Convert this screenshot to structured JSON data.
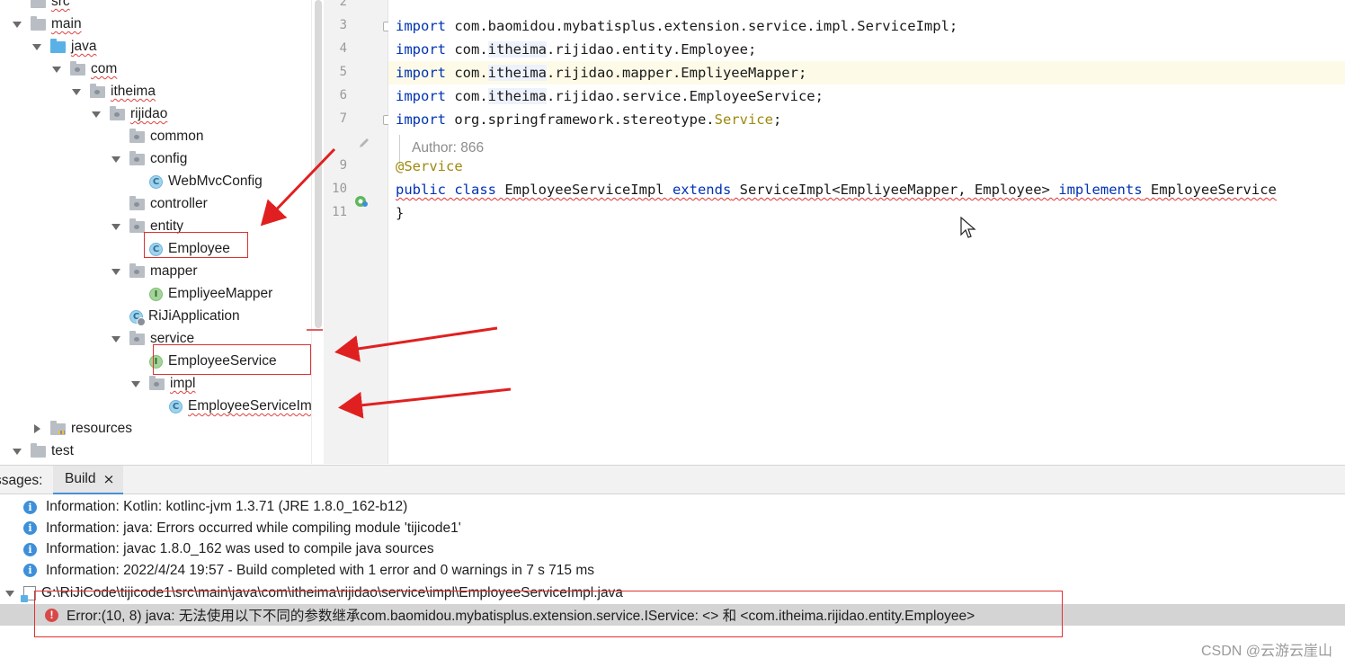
{
  "tree": {
    "items": [
      {
        "label": "src",
        "kind": "folder",
        "arrow": "none",
        "depth": 0,
        "squiggle": true
      },
      {
        "label": "main",
        "kind": "folder",
        "arrow": "down",
        "depth": 0,
        "squiggle": true
      },
      {
        "label": "java",
        "kind": "folder-blue",
        "arrow": "down",
        "depth": 1,
        "squiggle": true
      },
      {
        "label": "com",
        "kind": "package",
        "arrow": "down",
        "depth": 2,
        "squiggle": true
      },
      {
        "label": "itheima",
        "kind": "package",
        "arrow": "down",
        "depth": 3,
        "squiggle": true
      },
      {
        "label": "rijidao",
        "kind": "package",
        "arrow": "down",
        "depth": 4,
        "squiggle": true
      },
      {
        "label": "common",
        "kind": "package",
        "arrow": "none",
        "depth": 5,
        "squiggle": false
      },
      {
        "label": "config",
        "kind": "package",
        "arrow": "down",
        "depth": 5,
        "squiggle": false
      },
      {
        "label": "WebMvcConfig",
        "kind": "class",
        "arrow": "none",
        "depth": 6,
        "squiggle": false
      },
      {
        "label": "controller",
        "kind": "package",
        "arrow": "none",
        "depth": 5,
        "squiggle": false
      },
      {
        "label": "entity",
        "kind": "package",
        "arrow": "down",
        "depth": 5,
        "squiggle": false
      },
      {
        "label": "Employee",
        "kind": "class",
        "arrow": "none",
        "depth": 6,
        "squiggle": false
      },
      {
        "label": "mapper",
        "kind": "package",
        "arrow": "down",
        "depth": 5,
        "squiggle": false
      },
      {
        "label": "EmpliyeeMapper",
        "kind": "interface",
        "arrow": "none",
        "depth": 6,
        "squiggle": false
      },
      {
        "label": "RiJiApplication",
        "kind": "app",
        "arrow": "none",
        "depth": 5,
        "squiggle": false
      },
      {
        "label": "service",
        "kind": "package",
        "arrow": "down",
        "depth": 5,
        "squiggle": false
      },
      {
        "label": "EmployeeService",
        "kind": "interface",
        "arrow": "none",
        "depth": 6,
        "squiggle": false
      },
      {
        "label": "impl",
        "kind": "package",
        "arrow": "down",
        "depth": 6,
        "squiggle": true
      },
      {
        "label": "EmployeeServiceIm",
        "kind": "class",
        "arrow": "none",
        "depth": 7,
        "squiggle": true
      },
      {
        "label": "resources",
        "kind": "resources",
        "arrow": "right",
        "depth": 1,
        "squiggle": false
      },
      {
        "label": "test",
        "kind": "folder",
        "arrow": "down",
        "depth": 0,
        "squiggle": false
      }
    ]
  },
  "editor": {
    "lines": [
      {
        "num": "2",
        "tokens": []
      },
      {
        "num": "3",
        "fold": true,
        "tokens": [
          {
            "t": "import",
            "c": "kw"
          },
          {
            "t": " com.baomidou.mybatisplus.extension.service.impl.ServiceImpl;"
          }
        ]
      },
      {
        "num": "4",
        "tokens": [
          {
            "t": "import",
            "c": "kw"
          },
          {
            "t": " com."
          },
          {
            "t": "itheima",
            "c": "hl"
          },
          {
            "t": ".rijidao.entity.Employee;"
          }
        ]
      },
      {
        "num": "5",
        "tokens": [
          {
            "t": "import",
            "c": "kw"
          },
          {
            "t": " com."
          },
          {
            "t": "itheima",
            "c": "hl"
          },
          {
            "t": ".rijidao.mapper.EmpliyeeMapper;"
          }
        ]
      },
      {
        "num": "6",
        "tokens": [
          {
            "t": "import",
            "c": "kw"
          },
          {
            "t": " com."
          },
          {
            "t": "itheima",
            "c": "hl"
          },
          {
            "t": ".rijidao.service.EmployeeService;"
          }
        ]
      },
      {
        "num": "7",
        "fold": true,
        "tokens": [
          {
            "t": "import",
            "c": "kw"
          },
          {
            "t": " org.springframework.stereotype."
          },
          {
            "t": "Service",
            "c": "ann"
          },
          {
            "t": ";"
          }
        ]
      },
      {
        "num": "",
        "tokens": []
      },
      {
        "num": "9",
        "tokens": [
          {
            "t": "@Service",
            "c": "ann"
          }
        ]
      },
      {
        "num": "10",
        "tokens": [
          {
            "t": "public class",
            "c": "kw err"
          },
          {
            "t": " EmployeeServiceImpl ",
            "c": "err"
          },
          {
            "t": "extends",
            "c": "kw err"
          },
          {
            "t": " ServiceImpl<EmpliyeeMapper, Employee> ",
            "c": "err"
          },
          {
            "t": "implements",
            "c": "kw err"
          },
          {
            "t": " EmployeeService",
            "c": "err"
          }
        ]
      },
      {
        "num": "11",
        "tokens": [
          {
            "t": "}"
          }
        ]
      }
    ],
    "author": "Author: 866"
  },
  "panel": {
    "messages_label": "ssages:",
    "tab_label": "Build",
    "tab_close": "×",
    "info": [
      "Information: Kotlin: kotlinc-jvm 1.3.71 (JRE 1.8.0_162-b12)",
      "Information: java: Errors occurred while compiling module 'tijicode1'",
      "Information: javac 1.8.0_162 was used to compile java sources",
      "Information: 2022/4/24 19:57 - Build completed with 1 error and 0 warnings in 7 s 715 ms"
    ],
    "file_path": "G:\\RiJiCode\\tijicode1\\src\\main\\java\\com\\itheima\\rijidao\\service\\impl\\EmployeeServiceImpl.java",
    "error": "Error:(10, 8)  java: 无法使用以下不同的参数继承com.baomidou.mybatisplus.extension.service.IService: <> 和 <com.itheima.rijidao.entity.Employee>"
  },
  "watermark": "CSDN @云游云崖山",
  "colors": {
    "keyword": "#0033b3",
    "annotation": "#9e880d",
    "error_red": "#e03030",
    "info_blue": "#3d8fd9",
    "tab_underline": "#4a8fd8"
  }
}
